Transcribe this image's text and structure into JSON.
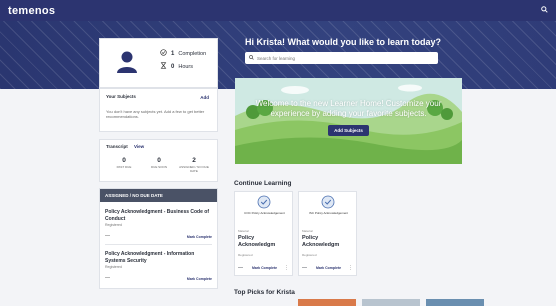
{
  "topbar": {
    "logo": "temenos",
    "search_icon": "search-icon"
  },
  "hero": {
    "greeting": "Hi Krista! What would you like to learn today?",
    "search_placeholder": "Search for learning"
  },
  "profile": {
    "completions_value": "1",
    "completions_label": "Completion",
    "hours_value": "0",
    "hours_label": "Hours"
  },
  "subjects": {
    "title": "Your Subjects",
    "add_label": "Add",
    "empty_text": "You don't have any subjects yet. Add a few to get better recommendations."
  },
  "transcript": {
    "title": "Transcript",
    "view_label": "View",
    "columns": [
      {
        "value": "0",
        "label": "PAST DUE"
      },
      {
        "value": "0",
        "label": "DUE SOON"
      },
      {
        "value": "2",
        "label": "ASSIGNED / NO DUE DATE"
      }
    ]
  },
  "assigned": {
    "header": "ASSIGNED / NO DUE DATE",
    "items": [
      {
        "title": "Policy Acknowledgment - Business Code of Conduct",
        "status": "Registered",
        "dash": "—",
        "action": "Mark Complete"
      },
      {
        "title": "Policy Acknowledgment - Information Systems Security",
        "status": "Registered",
        "dash": "—",
        "action": "Mark Complete"
      }
    ]
  },
  "banner": {
    "text": "Welcome to the new Learner Home! Customize your experience by adding your favorite subjects.",
    "button": "Add Subjects"
  },
  "continue": {
    "title": "Continue Learning",
    "courses": [
      {
        "badge": "COC Policy Acknowledgement",
        "type": "Material",
        "title": "Policy Acknowledgm",
        "status": "Registered",
        "dash": "—",
        "action": "Mark Complete",
        "more": "⋮"
      },
      {
        "badge": "ISC Policy Acknowledgement",
        "type": "Material",
        "title": "Policy Acknowledgm",
        "status": "Registered",
        "dash": "—",
        "action": "Mark Complete",
        "more": "⋮"
      }
    ]
  },
  "top_picks": {
    "title": "Top Picks for Krista"
  },
  "colors": {
    "brand": "#2c3470",
    "banner_sky": "#c8e6e0",
    "banner_grass": "#7fbf4a"
  }
}
